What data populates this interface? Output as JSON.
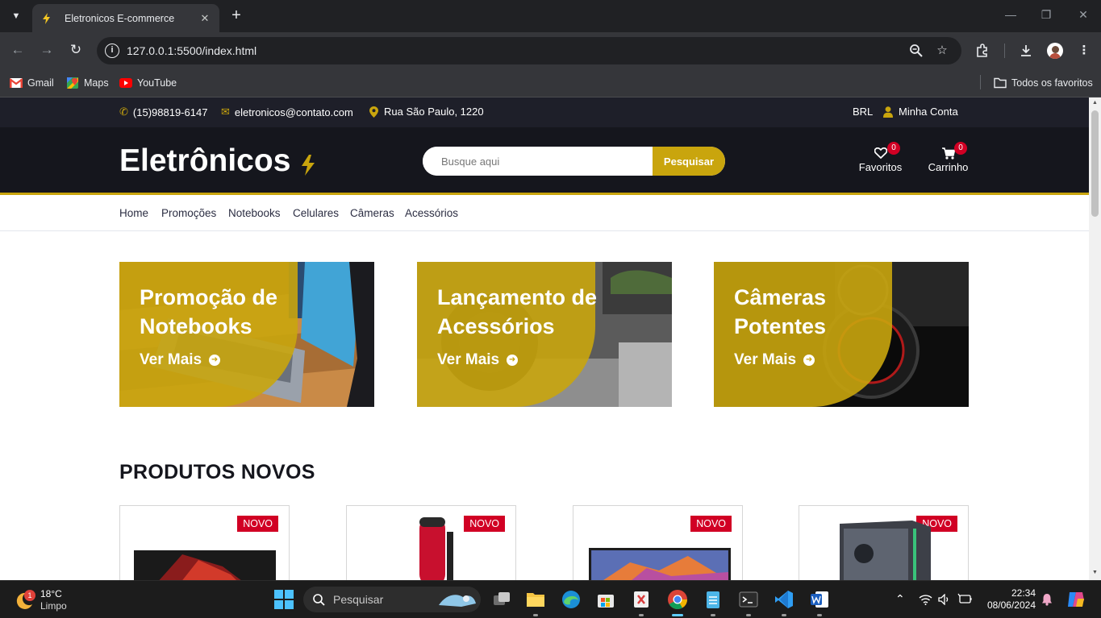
{
  "browser": {
    "tab_title": "Eletronicos E-commerce",
    "url": "127.0.0.1:5500/index.html",
    "bookmarks": [
      "Gmail",
      "Maps",
      "YouTube"
    ],
    "all_favorites": "Todos os favoritos"
  },
  "site": {
    "phone": "(15)98819-6147",
    "email": "eletronicos@contato.com",
    "address": "Rua São Paulo, 1220",
    "currency": "BRL",
    "account": "Minha Conta",
    "logo": "Eletrônicos",
    "search_placeholder": "Busque aqui",
    "search_button": "Pesquisar",
    "favorites_label": "Favoritos",
    "favorites_count": "0",
    "cart_label": "Carrinho",
    "cart_count": "0",
    "nav": [
      "Home",
      "Promoções",
      "Notebooks",
      "Celulares",
      "Câmeras",
      "Acessórios"
    ],
    "banners": [
      {
        "title": "Promoção de Notebooks",
        "link": "Ver Mais"
      },
      {
        "title": "Lançamento de Acessórios",
        "link": "Ver Mais"
      },
      {
        "title": "Câmeras Potentes",
        "link": "Ver Mais"
      }
    ],
    "section_title": "PRODUTOS NOVOS",
    "product_tags": [
      "NOVO",
      "NOVO",
      "NOVO",
      "NOVO"
    ]
  },
  "taskbar": {
    "weather_temp": "18°C",
    "weather_desc": "Limpo",
    "weather_badge": "1",
    "search_label": "Pesquisar",
    "time": "22:34",
    "date": "08/06/2024"
  },
  "colors": {
    "accent": "#c9a50d",
    "header_bg": "#15161d",
    "badge_red": "#d10024"
  }
}
